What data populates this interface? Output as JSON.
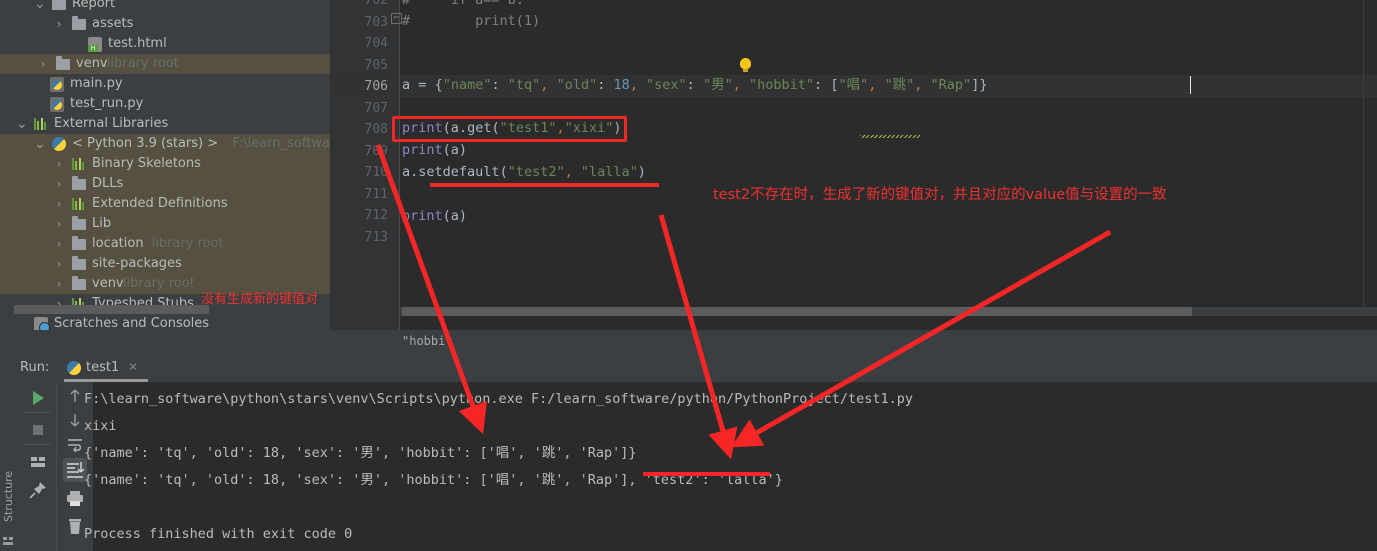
{
  "project_tree": {
    "rows": [
      {
        "label": "Report",
        "sub": "",
        "icon": "folder-icon",
        "indent": 52,
        "arrow": "v",
        "selected": false,
        "partial": true
      },
      {
        "label": "assets",
        "sub": "",
        "icon": "folder-icon",
        "indent": 72,
        "arrow": ">",
        "selected": false
      },
      {
        "label": "test.html",
        "sub": "",
        "icon": "html-file-icon",
        "indent": 88,
        "arrow": "",
        "selected": false
      },
      {
        "label": "venv",
        "sub": "library root",
        "icon": "folder-icon",
        "indent": 56,
        "arrow": ">",
        "selected": true
      },
      {
        "label": "main.py",
        "sub": "",
        "icon": "python-file-icon",
        "indent": 50,
        "arrow": "",
        "selected": false
      },
      {
        "label": "test_run.py",
        "sub": "",
        "icon": "python-file-icon",
        "indent": 50,
        "arrow": "",
        "selected": false
      },
      {
        "label": "External Libraries",
        "sub": "",
        "icon": "library-bars-icon",
        "indent": 34,
        "arrow": "v",
        "selected": false
      },
      {
        "label": "< Python 3.9 (stars) >",
        "sub": "F:\\learn_software\\pyth",
        "icon": "python-interpreter-icon",
        "indent": 52,
        "arrow": "v",
        "selected": true
      },
      {
        "label": "Binary Skeletons",
        "sub": "",
        "icon": "library-bars-icon",
        "indent": 72,
        "arrow": ">",
        "selected": true
      },
      {
        "label": "DLLs",
        "sub": "",
        "icon": "folder-icon",
        "indent": 72,
        "arrow": ">",
        "selected": true
      },
      {
        "label": "Extended Definitions",
        "sub": "",
        "icon": "library-bars-icon",
        "indent": 72,
        "arrow": ">",
        "selected": true
      },
      {
        "label": "Lib",
        "sub": "",
        "icon": "folder-icon",
        "indent": 72,
        "arrow": ">",
        "selected": true
      },
      {
        "label": "location",
        "sub": "library root",
        "icon": "folder-icon",
        "indent": 72,
        "arrow": ">",
        "selected": true
      },
      {
        "label": "site-packages",
        "sub": "",
        "icon": "folder-icon",
        "indent": 72,
        "arrow": ">",
        "selected": true
      },
      {
        "label": "venv",
        "sub": "library root",
        "icon": "folder-icon",
        "indent": 72,
        "arrow": ">",
        "selected": true
      },
      {
        "label": "Typeshed Stubs",
        "sub": "",
        "icon": "library-bars-icon",
        "indent": 72,
        "arrow": ">",
        "selected": false
      },
      {
        "label": "Scratches and Consoles",
        "sub": "",
        "icon": "scratches-icon",
        "indent": 34,
        "arrow": "",
        "selected": false
      }
    ]
  },
  "annotations": {
    "tree_note": "没有生成新的键值对",
    "editor_note": "test2不存在时，生成了新的键值对，并且对应的value值与设置的一致",
    "color": "#f62626"
  },
  "editor": {
    "line_numbers": [
      "702",
      "703",
      "704",
      "705",
      "706",
      "707",
      "708",
      "709",
      "710",
      "711",
      "712",
      "713"
    ],
    "current_line": "706",
    "lines": [
      {
        "n": "702",
        "text": "#     if a== b:",
        "type": "comment"
      },
      {
        "n": "703",
        "text": "#        print(1)",
        "type": "comment"
      },
      {
        "n": "704",
        "text": "",
        "type": "blank"
      },
      {
        "n": "705",
        "text": "",
        "type": "blank"
      },
      {
        "n": "706",
        "text": "a = {\"name\": \"tq\", \"old\": 18, \"sex\": \"男\", \"hobbit\": [\"唱\", \"跳\", \"Rap\"]}",
        "type": "code"
      },
      {
        "n": "707",
        "text": "",
        "type": "blank"
      },
      {
        "n": "708",
        "text": "print(a.get(\"test1\",\"xixi\"))",
        "type": "code"
      },
      {
        "n": "709",
        "text": "print(a)",
        "type": "code"
      },
      {
        "n": "710",
        "text": "a.setdefault(\"test2\", \"lalla\")",
        "type": "code"
      },
      {
        "n": "711",
        "text": "",
        "type": "blank"
      },
      {
        "n": "712",
        "text": "print(a)",
        "type": "code"
      },
      {
        "n": "713",
        "text": "",
        "type": "blank"
      }
    ],
    "breadcrumb": "\"hobbit"
  },
  "run_panel": {
    "run_label": "Run:",
    "tab_name": "test1",
    "tab_close": "✕",
    "structure_label": "Structure",
    "toolbar_left": [
      "run-icon",
      "stop-icon",
      "layout-icon",
      "pin-icon"
    ],
    "toolbar_right": [
      "up-arrow-icon",
      "down-arrow-icon",
      "soft-wrap-icon",
      "scroll-to-end-icon",
      "print-icon",
      "trash-icon"
    ],
    "console_lines": [
      "F:\\learn_software\\python\\stars\\venv\\Scripts\\python.exe F:/learn_software/python/PythonProject/test1.py",
      "xixi",
      "{'name': 'tq', 'old': 18, 'sex': '男', 'hobbit': ['唱', '跳', 'Rap']}",
      "{'name': 'tq', 'old': 18, 'sex': '男', 'hobbit': ['唱', '跳', 'Rap'], 'test2': 'lalla'}",
      "",
      "Process finished with exit code 0"
    ]
  },
  "colors": {
    "bg_panel": "#3c3f41",
    "bg_editor": "#2b2b2b",
    "selection": "#55503f",
    "accent_red": "#f62626",
    "string_green": "#6a8759",
    "number_blue": "#6897bb",
    "keyword_purple": "#8888c6"
  }
}
